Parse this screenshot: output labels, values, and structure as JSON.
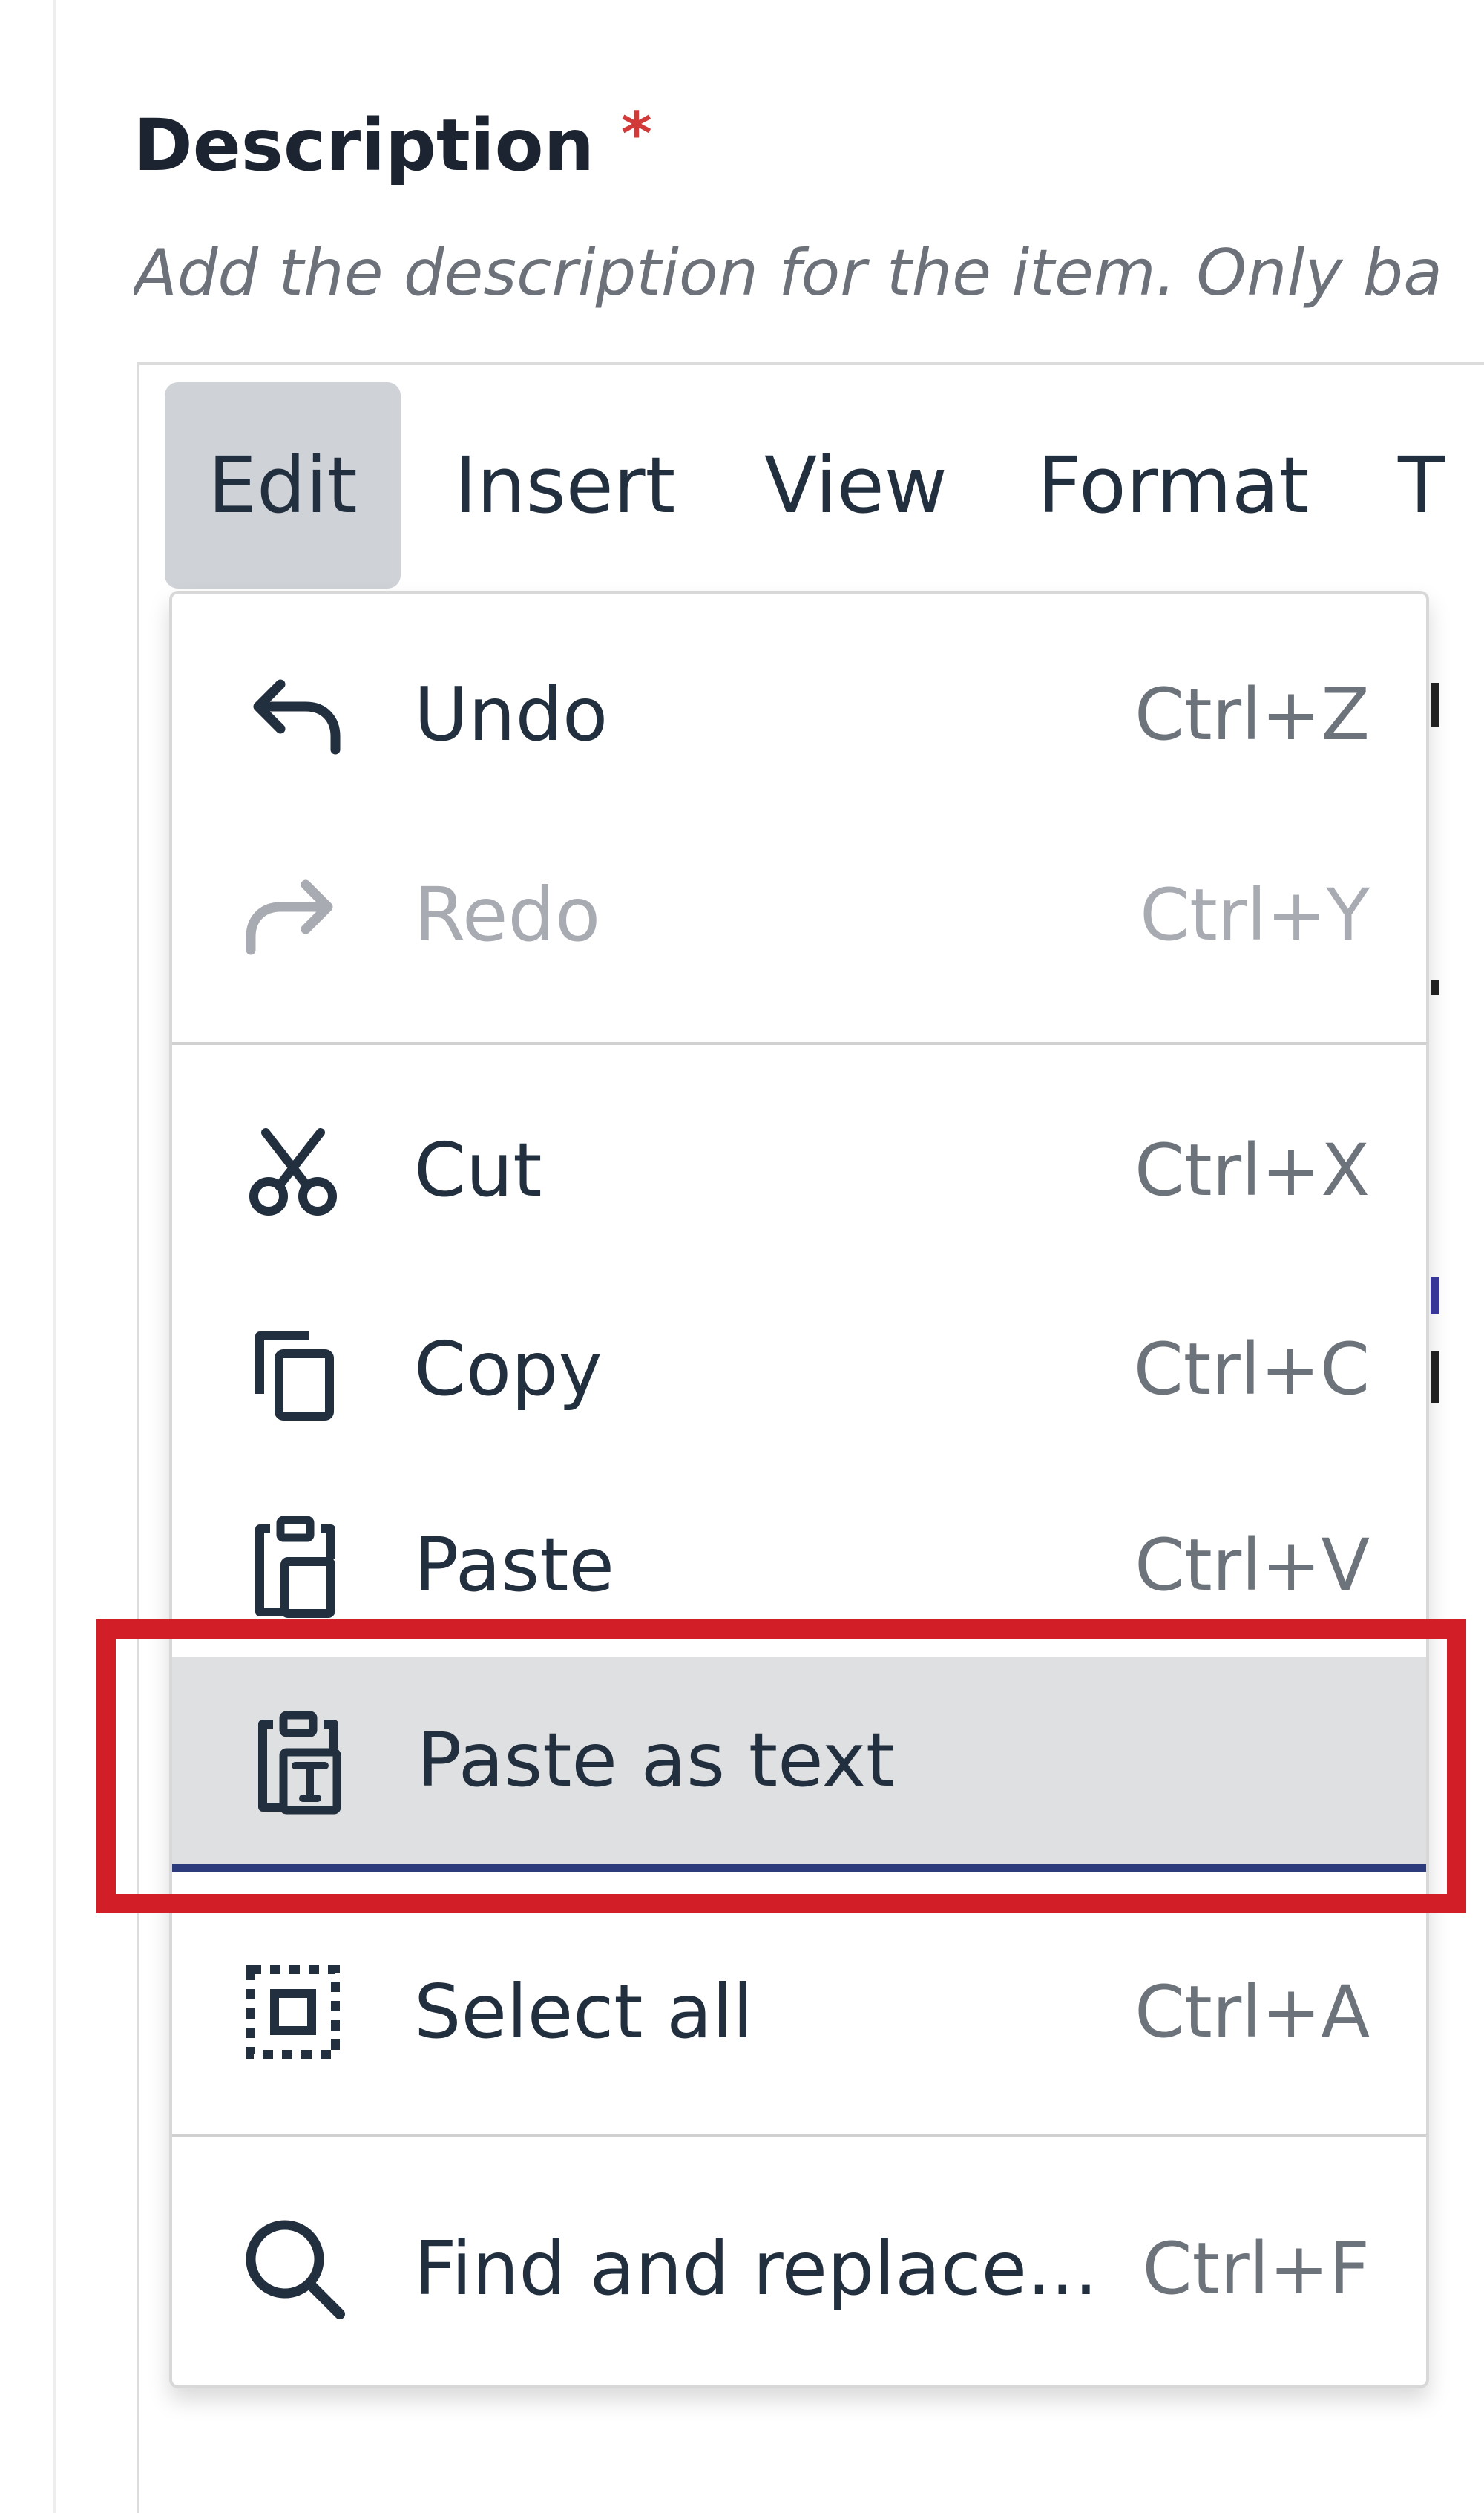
{
  "field": {
    "label": "Description",
    "required_mark": "*",
    "help_text": "Add the description for the item. Only ba"
  },
  "menubar": {
    "items": [
      {
        "label": "Edit",
        "active": true
      },
      {
        "label": "Insert"
      },
      {
        "label": "View"
      },
      {
        "label": "Format"
      },
      {
        "label": "T"
      }
    ]
  },
  "edit_menu": {
    "items": [
      {
        "label": "Undo",
        "shortcut": "Ctrl+Z",
        "icon": "undo-icon",
        "disabled": false
      },
      {
        "label": "Redo",
        "shortcut": "Ctrl+Y",
        "icon": "redo-icon",
        "disabled": true
      },
      {
        "label": "Cut",
        "shortcut": "Ctrl+X",
        "icon": "cut-icon",
        "disabled": false
      },
      {
        "label": "Copy",
        "shortcut": "Ctrl+C",
        "icon": "copy-icon",
        "disabled": false
      },
      {
        "label": "Paste",
        "shortcut": "Ctrl+V",
        "icon": "paste-icon",
        "disabled": false
      },
      {
        "label": "Paste as text",
        "shortcut": "",
        "icon": "paste-as-text-icon",
        "highlighted": true
      },
      {
        "label": "Select all",
        "shortcut": "Ctrl+A",
        "icon": "select-all-icon",
        "disabled": false
      },
      {
        "label": "Find and replace...",
        "shortcut": "Ctrl+F",
        "icon": "search-icon",
        "disabled": false
      }
    ]
  },
  "colors": {
    "text": "#222f3e",
    "muted": "#6d737b",
    "disabled": "#a8acb2",
    "active_menu_bg": "#cfd2d7",
    "highlight_bg": "#dee0e2",
    "highlight_underline": "#2b3b7c",
    "annotation_red": "#d21f27",
    "required": "#d23a3a"
  }
}
